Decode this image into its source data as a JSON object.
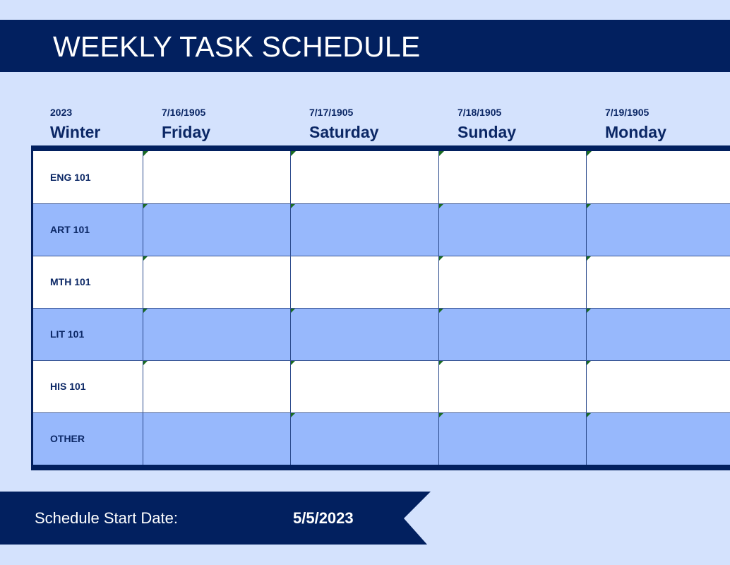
{
  "title": "WEEKLY TASK SCHEDULE",
  "colors": {
    "background": "#d4e2fd",
    "navy": "#02205f",
    "row_alt": "#97b8fc",
    "row_plain": "#ffffff",
    "text_dark": "#0b2765",
    "cell_marker": "#1a6b22"
  },
  "header": {
    "term": {
      "year": "2023",
      "season": "Winter"
    },
    "days": [
      {
        "date": "7/16/1905",
        "name": "Friday"
      },
      {
        "date": "7/17/1905",
        "name": "Saturday"
      },
      {
        "date": "7/18/1905",
        "name": "Sunday"
      },
      {
        "date": "7/19/1905",
        "name": "Monday"
      }
    ]
  },
  "rows": [
    {
      "label": "ENG 101",
      "style": "white",
      "cells": [
        "",
        "",
        "",
        ""
      ],
      "markers": [
        true,
        true,
        true,
        true
      ]
    },
    {
      "label": "ART 101",
      "style": "blue",
      "cells": [
        "",
        "",
        "",
        ""
      ],
      "markers": [
        true,
        true,
        true,
        true
      ]
    },
    {
      "label": "MTH 101",
      "style": "white",
      "cells": [
        "",
        "",
        "",
        ""
      ],
      "markers": [
        true,
        false,
        true,
        true
      ]
    },
    {
      "label": "LIT 101",
      "style": "blue",
      "cells": [
        "",
        "",
        "",
        ""
      ],
      "markers": [
        true,
        true,
        true,
        true
      ]
    },
    {
      "label": "HIS 101",
      "style": "white",
      "cells": [
        "",
        "",
        "",
        ""
      ],
      "markers": [
        true,
        true,
        true,
        true
      ]
    },
    {
      "label": "OTHER",
      "style": "blue",
      "cells": [
        "",
        "",
        "",
        ""
      ],
      "markers": [
        false,
        true,
        true,
        true
      ]
    }
  ],
  "footer": {
    "start_date_label": "Schedule Start Date:",
    "start_date_value": "5/5/2023"
  }
}
